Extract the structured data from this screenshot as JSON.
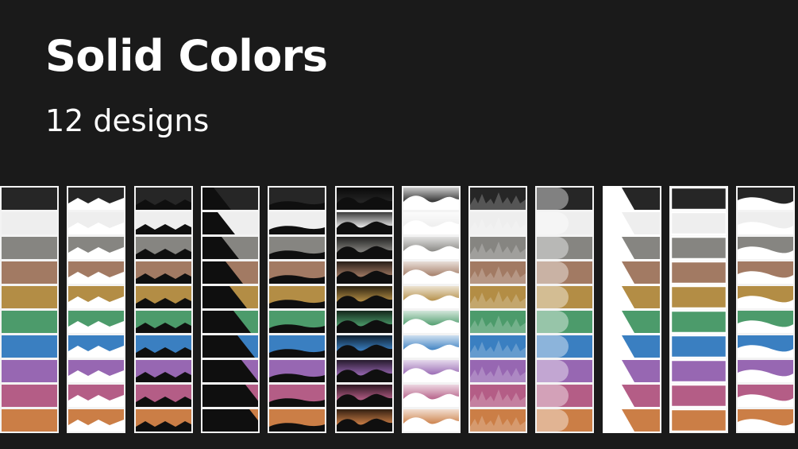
{
  "title": "Solid Colors",
  "subtitle": "12 designs",
  "colors": {
    "background": "#1a1a1a",
    "frame": "#f3f3f3",
    "swatches": [
      "#262626",
      "#eeeeee",
      "#868581",
      "#a27a63",
      "#b38d45",
      "#4c9b6b",
      "#3a7fc1",
      "#9767b2",
      "#b45d86",
      "#cb7e46"
    ]
  },
  "designs": [
    {
      "name": "plain"
    },
    {
      "name": "zigzag-white"
    },
    {
      "name": "zigzag-black"
    },
    {
      "name": "diagonal-black"
    },
    {
      "name": "wave-black-thin"
    },
    {
      "name": "wave-black-gradient"
    },
    {
      "name": "wave-white-gradient"
    },
    {
      "name": "spiky-wave"
    },
    {
      "name": "rounded-white"
    },
    {
      "name": "diagonal-white"
    },
    {
      "name": "inset"
    },
    {
      "name": "wave-white"
    }
  ]
}
